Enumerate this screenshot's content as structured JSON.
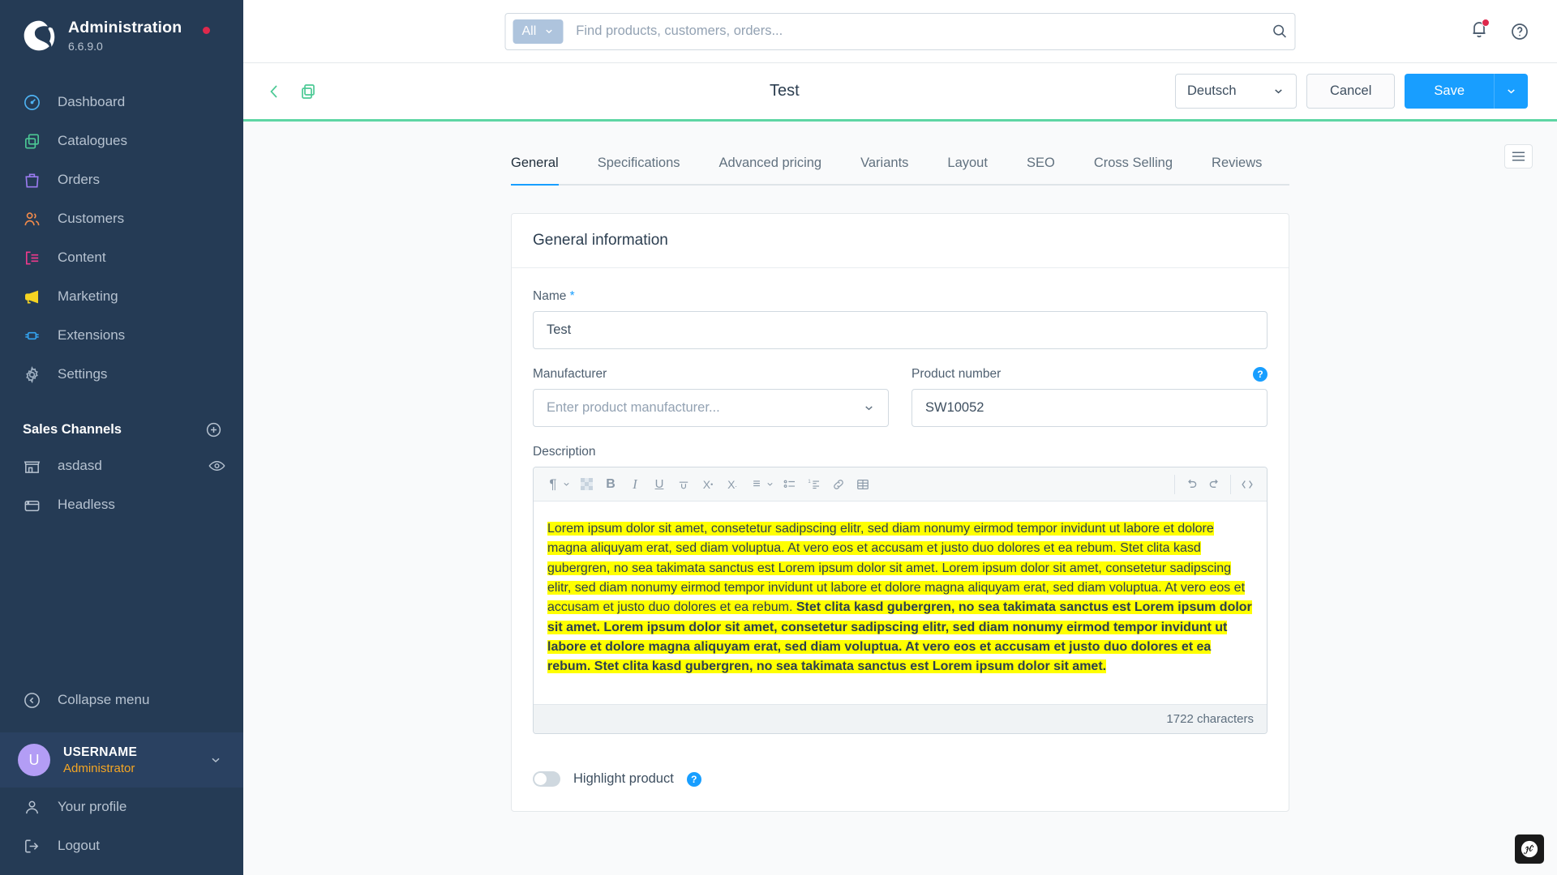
{
  "sidebar": {
    "brand": {
      "title": "Administration",
      "version": "6.6.9.0",
      "logo_icon": "shopware-logo-icon",
      "status_dot": "update-available-dot"
    },
    "nav": [
      {
        "label": "Dashboard",
        "icon": "dashboard-icon",
        "color": "#4eb2f2"
      },
      {
        "label": "Catalogues",
        "icon": "catalogue-icon",
        "color": "#4cc995"
      },
      {
        "label": "Orders",
        "icon": "orders-icon",
        "color": "#9b7bf0"
      },
      {
        "label": "Customers",
        "icon": "customers-icon",
        "color": "#f28b4b"
      },
      {
        "label": "Content",
        "icon": "content-icon",
        "color": "#ee3a8c"
      },
      {
        "label": "Marketing",
        "icon": "marketing-icon",
        "color": "#f5d422"
      },
      {
        "label": "Extensions",
        "icon": "extensions-icon",
        "color": "#34a3ef"
      },
      {
        "label": "Settings",
        "icon": "settings-icon",
        "color": "#9fb0c2"
      }
    ],
    "sales_channels": {
      "title": "Sales Channels",
      "add_icon": "plus-circle-icon",
      "items": [
        {
          "label": "asdasd",
          "icon": "storefront-icon",
          "trailing_icon": "eye-icon"
        },
        {
          "label": "Headless",
          "icon": "headless-icon",
          "trailing_icon": ""
        }
      ]
    },
    "collapse": {
      "label": "Collapse menu",
      "icon": "chevron-left-circle-icon"
    },
    "user": {
      "initial": "U",
      "name": "USERNAME",
      "role": "Administrator",
      "caret_icon": "chevron-down-icon"
    },
    "footer": [
      {
        "label": "Your profile",
        "icon": "user-icon"
      },
      {
        "label": "Logout",
        "icon": "logout-icon"
      }
    ]
  },
  "topbar": {
    "search": {
      "scope": "All",
      "scope_caret_icon": "chevron-down-icon",
      "placeholder": "Find products, customers, orders...",
      "value": "",
      "search_icon": "search-icon"
    },
    "notifications_icon": "bell-icon",
    "notifications_has_badge": true,
    "help_icon": "question-circle-icon"
  },
  "product_header": {
    "back_icon": "chevron-left-icon",
    "duplicate_icon": "copy-icon",
    "title": "Test",
    "language": {
      "value": "Deutsch",
      "caret_icon": "chevron-down-icon"
    },
    "cancel_label": "Cancel",
    "save_label": "Save",
    "save_caret_icon": "chevron-down-icon",
    "accent_color": "#5ed6a4"
  },
  "content": {
    "sidebar_toggle_icon": "panel-toggle-icon",
    "tabs": [
      {
        "label": "General",
        "active": true
      },
      {
        "label": "Specifications",
        "active": false
      },
      {
        "label": "Advanced pricing",
        "active": false
      },
      {
        "label": "Variants",
        "active": false
      },
      {
        "label": "Layout",
        "active": false
      },
      {
        "label": "SEO",
        "active": false
      },
      {
        "label": "Cross Selling",
        "active": false
      },
      {
        "label": "Reviews",
        "active": false
      }
    ],
    "card_title": "General information",
    "name_field": {
      "label": "Name",
      "required_mark": "*",
      "value": "Test"
    },
    "manufacturer_field": {
      "label": "Manufacturer",
      "placeholder": "Enter product manufacturer...",
      "value": "",
      "caret_icon": "chevron-down-icon"
    },
    "product_number_field": {
      "label": "Product number",
      "value": "SW10052",
      "help_icon": "question-badge-icon",
      "help_badge_text": "?"
    },
    "description_field": {
      "label": "Description",
      "toolbar": [
        {
          "name": "paragraph-format-icon",
          "glyph": "¶",
          "caret": true
        },
        {
          "name": "text-color-icon",
          "glyph": "",
          "caret": false
        },
        {
          "name": "bold-icon",
          "glyph": "B",
          "caret": false
        },
        {
          "name": "italic-icon",
          "glyph": "I",
          "caret": false
        },
        {
          "name": "underline-icon",
          "glyph": "U",
          "caret": false
        },
        {
          "name": "strikethrough-icon",
          "glyph": "S",
          "caret": false
        },
        {
          "name": "superscript-icon",
          "glyph": "X",
          "caret": false
        },
        {
          "name": "subscript-icon",
          "glyph": "X",
          "caret": false
        },
        {
          "name": "align-icon",
          "glyph": "≡",
          "caret": true
        },
        {
          "name": "bullet-list-icon",
          "glyph": "",
          "caret": false
        },
        {
          "name": "numbered-list-icon",
          "glyph": "",
          "caret": false
        },
        {
          "name": "link-icon",
          "glyph": "",
          "caret": false
        },
        {
          "name": "table-icon",
          "glyph": "",
          "caret": false
        }
      ],
      "toolbar_right": [
        {
          "name": "undo-icon"
        },
        {
          "name": "redo-icon"
        },
        {
          "name": "code-view-icon"
        }
      ],
      "body_part_1": "Lorem ipsum dolor sit amet, consetetur sadipscing elitr, sed diam nonumy eirmod tempor invidunt ut labore et dolore magna aliquyam erat, sed diam voluptua. At vero eos et accusam et justo duo dolores et ea rebum. Stet clita kasd gubergren, no sea takimata sanctus est Lorem ipsum dolor sit amet. Lorem ipsum dolor sit amet, consetetur sadipscing elitr, sed diam nonumy eirmod tempor invidunt ut labore et dolore magna aliquyam erat, sed diam voluptua. At vero eos et accusam et justo duo dolores et ea rebum. ",
      "body_part_2_bold": "Stet clita kasd gubergren, no sea takimata sanctus est Lorem ipsum dolor sit amet. Lorem ipsum dolor sit amet, consetetur sadipscing elitr, sed diam nonumy eirmod tempor invidunt ut labore et dolore magna aliquyam erat, sed diam voluptua. At vero eos et accusam et justo duo dolores et ea rebum. Stet clita kasd gubergren, no sea takimata sanctus est Lorem ipsum dolor sit amet.",
      "character_count": "1722 characters",
      "highlight_color": "#ffff00"
    },
    "highlight_toggle": {
      "label": "Highlight product",
      "checked": false,
      "help_badge_text": "?"
    }
  },
  "debug_badge": {
    "icon": "symfony-logo-icon"
  }
}
